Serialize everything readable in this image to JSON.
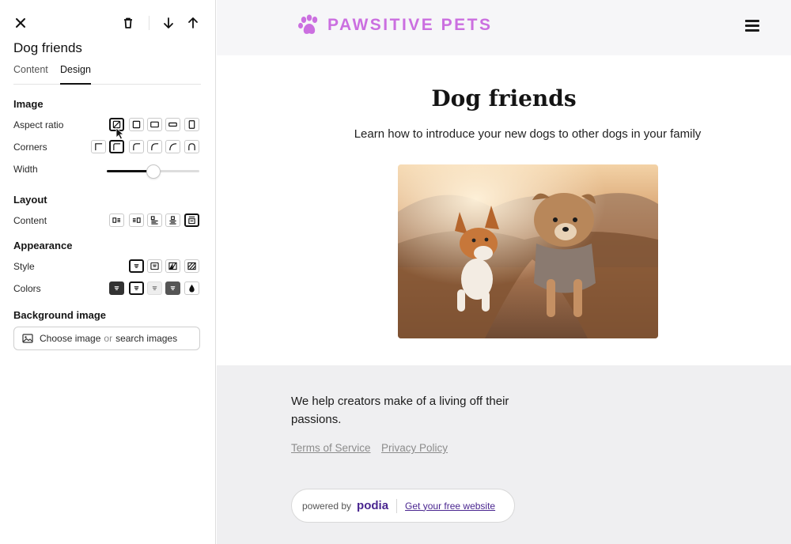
{
  "editor": {
    "block_title": "Dog friends",
    "tabs": [
      {
        "label": "Content",
        "active": false
      },
      {
        "label": "Design",
        "active": true
      }
    ],
    "sections": {
      "image": "Image",
      "layout": "Layout",
      "appearance": "Appearance",
      "background_image": "Background image"
    },
    "rows": {
      "aspect_ratio": "Aspect ratio",
      "corners": "Corners",
      "width": "Width",
      "content": "Content",
      "style": "Style",
      "colors": "Colors"
    },
    "width_value": 0.5,
    "background_picker": {
      "choose": "Choose image",
      "or": "or",
      "search": "search images"
    }
  },
  "site": {
    "logo_text": "PAWSITIVE PETS",
    "brand_color": "#cb6fe0",
    "hero_title": "Dog friends",
    "hero_subtitle": "Learn how to introduce your new dogs to other dogs in your family",
    "footer": {
      "tagline": "We help creators make of a living off their passions.",
      "links": [
        "Terms of Service",
        "Privacy Policy"
      ],
      "powered_by": "powered by",
      "powered_brand": "podia",
      "cta": "Get your free website"
    }
  }
}
